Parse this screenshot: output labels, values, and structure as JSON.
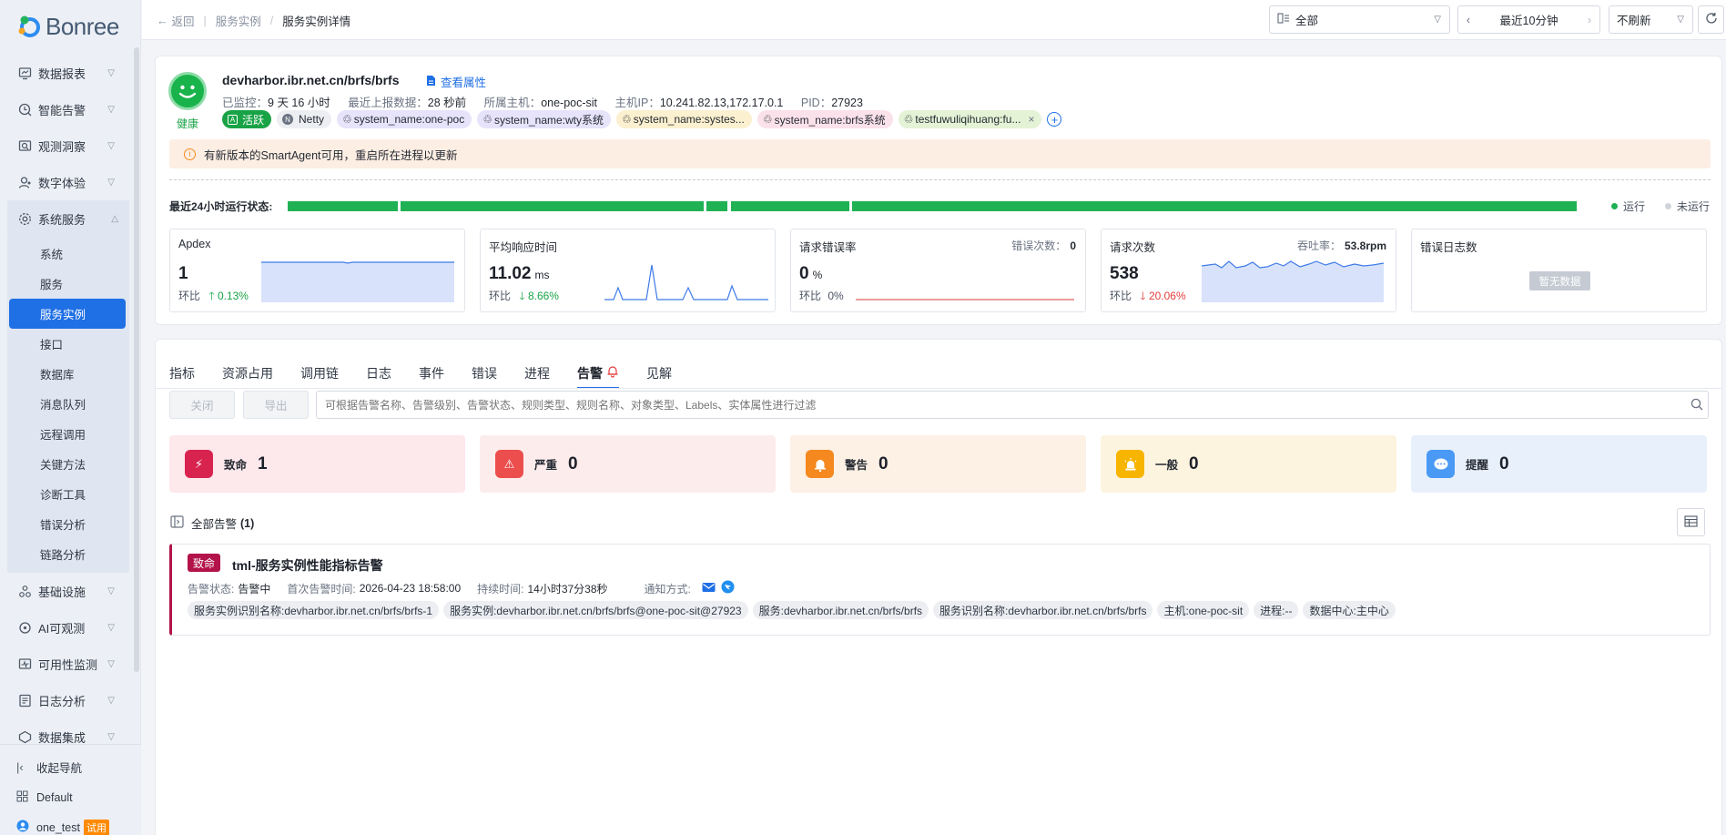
{
  "brand": {
    "name": "Bonree"
  },
  "sidebar": {
    "items": [
      {
        "label": "数据报表",
        "icon": "report-icon"
      },
      {
        "label": "智能告警",
        "icon": "alert-icon"
      },
      {
        "label": "观测洞察",
        "icon": "insight-icon"
      },
      {
        "label": "数字体验",
        "icon": "user-experience-icon"
      },
      {
        "label": "系统服务",
        "icon": "system-service-icon",
        "expanded": true
      }
    ],
    "sub_items": [
      "系统",
      "服务",
      "服务实例",
      "接口",
      "数据库",
      "消息队列",
      "远程调用",
      "关键方法",
      "诊断工具",
      "错误分析",
      "链路分析"
    ],
    "active_sub": "服务实例",
    "items_after": [
      {
        "label": "基础设施",
        "icon": "infrastructure-icon"
      },
      {
        "label": "AI可观测",
        "icon": "ai-observability-icon"
      },
      {
        "label": "可用性监测",
        "icon": "availability-icon"
      },
      {
        "label": "日志分析",
        "icon": "log-analysis-icon"
      },
      {
        "label": "数据集成",
        "icon": "data-integration-icon"
      }
    ],
    "collapse_label": "收起导航",
    "workspace": "Default",
    "user": "one_test",
    "trial_badge": "试用"
  },
  "topbar": {
    "back": "返回",
    "breadcrumb": [
      "服务实例",
      "服务实例详情"
    ],
    "env_select": "全部",
    "time_range": "最近10分钟",
    "refresh_select": "不刷新"
  },
  "instance": {
    "health_label": "健康",
    "name": "devharbor.ibr.net.cn/brfs/brfs",
    "view_props": "查看属性",
    "meta": [
      {
        "label": "已监控：",
        "value": "9 天 16 小时"
      },
      {
        "label": "最近上报数据：",
        "value": "28 秒前"
      },
      {
        "label": "所属主机：",
        "value": "one-poc-sit"
      },
      {
        "label": "主机IP：",
        "value": "10.241.82.13,172.17.0.1"
      },
      {
        "label": "PID：",
        "value": "27923"
      }
    ],
    "tags": [
      {
        "text": "活跃",
        "kind": "active"
      },
      {
        "text": "Netty",
        "kind": "netty"
      },
      {
        "text": "system_name:one-poc",
        "kind": "purple"
      },
      {
        "text": "system_name:wty系统",
        "kind": "purple"
      },
      {
        "text": "system_name:systes...",
        "kind": "yellow"
      },
      {
        "text": "system_name:brfs系统",
        "kind": "pink"
      },
      {
        "text": "testfuwuliqihuang:fu...",
        "kind": "green"
      }
    ],
    "notice": "有新版本的SmartAgent可用，重启所在进程以更新",
    "status_label": "最近24小时运行状态:",
    "legend_running": "运行",
    "legend_not_running": "未运行",
    "colors": {
      "running": "#1fb153",
      "not_running": "#d0d4da"
    }
  },
  "metrics": [
    {
      "title": "Apdex",
      "value": "1",
      "unit": "",
      "ratio_label": "环比",
      "ratio": "0.13%",
      "trend": "up"
    },
    {
      "title": "平均响应时间",
      "value": "11.02",
      "unit": "ms",
      "ratio_label": "环比",
      "ratio": "8.66%",
      "trend": "down-good"
    },
    {
      "title": "请求错误率",
      "value": "0",
      "unit": "%",
      "ratio_label": "环比",
      "ratio": "0%",
      "trend": "none",
      "right_label": "错误次数：",
      "right_value": "0"
    },
    {
      "title": "请求次数",
      "value": "538",
      "unit": "",
      "ratio_label": "环比",
      "ratio": "20.06%",
      "trend": "down-bad",
      "right_label": "吞吐率：",
      "right_value": "53.8rpm"
    },
    {
      "title": "错误日志数",
      "no_data": "暂无数据"
    }
  ],
  "tabs": [
    "指标",
    "资源占用",
    "调用链",
    "日志",
    "事件",
    "错误",
    "进程",
    "告警",
    "见解"
  ],
  "active_tab": "告警",
  "toolbar": {
    "close_label": "关闭",
    "export_label": "导出",
    "search_placeholder": "可根据告警名称、告警级别、告警状态、规则类型、规则名称、对象类型、Labels、实体属性进行过滤"
  },
  "severities": [
    {
      "name": "致命",
      "count": "1",
      "color": "#d9234f",
      "bg": "#fde8ec"
    },
    {
      "name": "严重",
      "count": "0",
      "color": "#ec4e4e",
      "bg": "#fdecec"
    },
    {
      "name": "警告",
      "count": "0",
      "color": "#f5891f",
      "bg": "#fdf0e5"
    },
    {
      "name": "一般",
      "count": "0",
      "color": "#f7b500",
      "bg": "#fdf4df"
    },
    {
      "name": "提醒",
      "count": "0",
      "color": "#4a9af5",
      "bg": "#e8f0fc"
    }
  ],
  "alerts_header": {
    "label": "全部告警",
    "count": "(1)"
  },
  "alert": {
    "level": "致命",
    "title": "tml-服务实例性能指标告警",
    "status_label": "告警状态:",
    "status": "告警中",
    "first_time_label": "首次告警时间:",
    "first_time": "2026-04-23 18:58:00",
    "duration_label": "持续时间:",
    "duration": "14小时37分38秒",
    "notify_label": "通知方式:",
    "chips": [
      "服务实例识别名称:devharbor.ibr.net.cn/brfs/brfs-1",
      "服务实例:devharbor.ibr.net.cn/brfs/brfs@one-poc-sit@27923",
      "服务:devharbor.ibr.net.cn/brfs/brfs",
      "服务识别名称:devharbor.ibr.net.cn/brfs/brfs",
      "主机:one-poc-sit",
      "进程:--",
      "数据中心:主中心"
    ]
  }
}
